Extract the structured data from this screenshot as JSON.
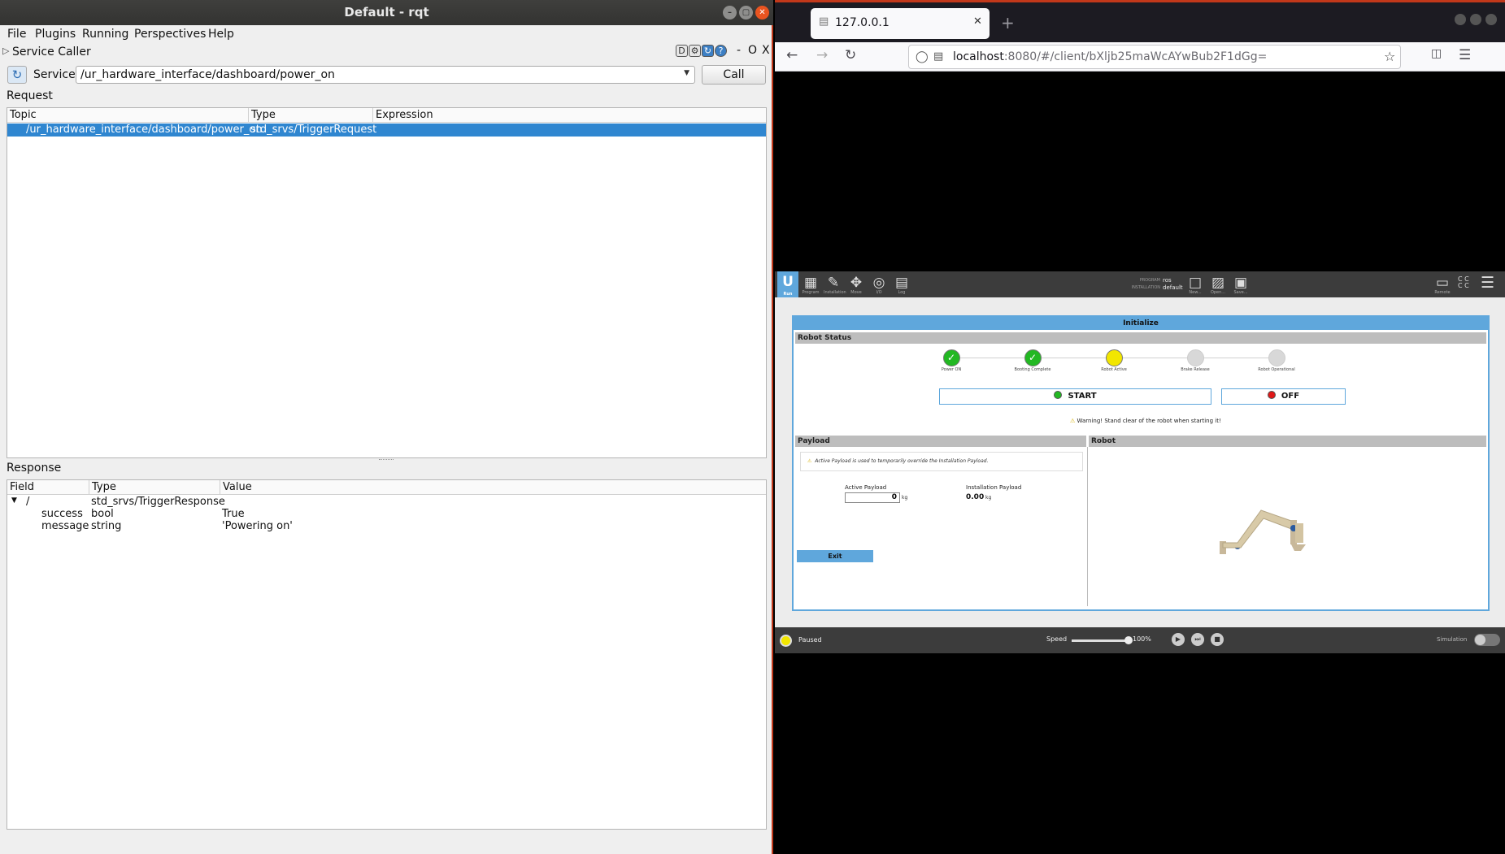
{
  "rqt": {
    "title": "Default - rqt",
    "menu": [
      "File",
      "Plugins",
      "Running",
      "Perspectives",
      "Help"
    ],
    "plugin_title": "Service Caller",
    "plugin_controls": [
      "D",
      "⚙",
      "↻",
      "?",
      "-",
      "O",
      "X"
    ],
    "service_label": "Service",
    "service_value": "/ur_hardware_interface/dashboard/power_on",
    "call_label": "Call",
    "request_label": "Request",
    "request_headers": [
      "Topic",
      "Type",
      "Expression"
    ],
    "request_row": {
      "topic": "/ur_hardware_interface/dashboard/power_on",
      "type": "std_srvs/TriggerRequest",
      "expression": ""
    },
    "response_label": "Response",
    "response_headers": [
      "Field",
      "Type",
      "Value"
    ],
    "response_rows": [
      {
        "field": "/",
        "type": "std_srvs/TriggerResponse",
        "value": ""
      },
      {
        "field": "success",
        "type": "bool",
        "value": "True"
      },
      {
        "field": "message",
        "type": "string",
        "value": "'Powering on'"
      }
    ]
  },
  "browser": {
    "tab_title": "127.0.0.1",
    "url_host": "localhost",
    "url_rest": ":8080/#/client/bXljb25maWcAYwBub2F1dGg="
  },
  "polyscope": {
    "toolbar": [
      {
        "icon": "ur-logo-icon",
        "label": "Run"
      },
      {
        "icon": "program-icon",
        "label": "Program"
      },
      {
        "icon": "installation-icon",
        "label": "Installation"
      },
      {
        "icon": "move-icon",
        "label": "Move"
      },
      {
        "icon": "io-icon",
        "label": "I/O"
      },
      {
        "icon": "log-icon",
        "label": "Log"
      }
    ],
    "program_label": "PROGRAM",
    "program_value": "ros",
    "installation_label": "INSTALLATION",
    "installation_value": "default",
    "file_buttons": [
      "New...",
      "Open...",
      "Save..."
    ],
    "remote_label": "Remote",
    "dialog_title": "Initialize",
    "robot_status_label": "Robot Status",
    "steps": [
      {
        "label": "Power ON",
        "state": "done",
        "color": "#22b822"
      },
      {
        "label": "Booting Complete",
        "state": "done",
        "color": "#22b822"
      },
      {
        "label": "Robot Active",
        "state": "active",
        "color": "#f2e600"
      },
      {
        "label": "Brake Release",
        "state": "pending",
        "color": "#d8d8d8"
      },
      {
        "label": "Robot Operational",
        "state": "pending",
        "color": "#d8d8d8"
      }
    ],
    "start_label": "START",
    "off_label": "OFF",
    "warning": "Warning! Stand clear of the robot when starting it!",
    "payload_label": "Payload",
    "robot_label": "Robot",
    "payload_note": "Active Payload is used to temporarily override the Installation Payload.",
    "active_payload_label": "Active Payload",
    "active_payload_value": "0",
    "installation_payload_label": "Installation Payload",
    "installation_payload_value": "0.00",
    "unit": "kg",
    "exit_label": "Exit",
    "status": "Paused",
    "speed_label": "Speed",
    "speed_value": "100%",
    "speed_fraction": 1.0,
    "simulation_label": "Simulation"
  }
}
